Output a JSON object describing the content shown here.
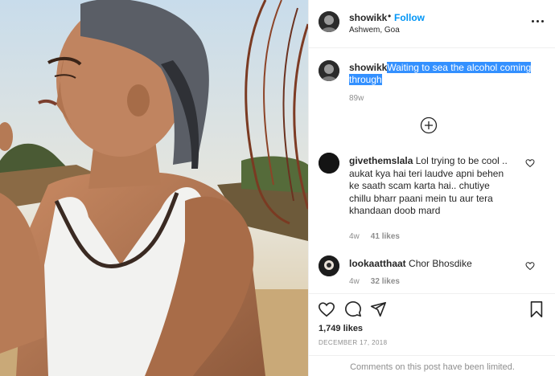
{
  "header": {
    "username": "showikk",
    "dot": "•",
    "follow_label": "Follow",
    "location": "Ashwem, Goa"
  },
  "caption": {
    "username": "showikk",
    "text": "Waiting to sea the alcohol coming through",
    "time": "89w"
  },
  "comments": [
    {
      "username": "givethemslala",
      "text": "Lol trying to be cool .. aukat kya hai teri laudve apni behen ke saath scam karta hai.. chutiye chillu bharr paani mein tu aur tera khandaan doob mard",
      "time": "4w",
      "likes": "41 likes"
    },
    {
      "username": "lookaatthaat",
      "text": "Chor Bhosdike",
      "time": "4w",
      "likes": "32 likes"
    }
  ],
  "likes": "1,749 likes",
  "date": "DECEMBER 17, 2018",
  "comments_limited": "Comments on this post have been limited.",
  "icons": {
    "more": "more-options-icon",
    "load_more": "plus-circle-icon",
    "like": "heart-icon",
    "comment": "comment-icon",
    "share": "share-icon",
    "save": "bookmark-icon"
  },
  "colors": {
    "link_blue": "#0095f6",
    "highlight": "#3390ff",
    "muted": "#8e8e8e",
    "text": "#262626"
  }
}
